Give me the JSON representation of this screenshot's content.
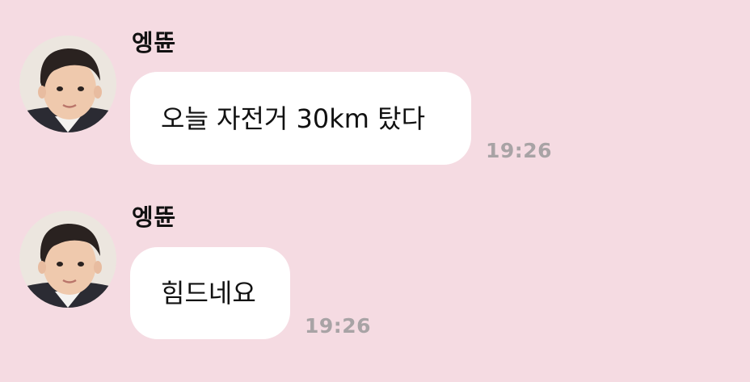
{
  "chat": {
    "background_color": "#f5dbe2",
    "messages": [
      {
        "sender": "엥뜐",
        "avatar_icon": "child-profile-photo",
        "text": "오늘 자전거 30km 탔다",
        "time": "19:26"
      },
      {
        "sender": "엥뜐",
        "avatar_icon": "child-profile-photo",
        "text": "힘드네요",
        "time": "19:26"
      }
    ]
  }
}
